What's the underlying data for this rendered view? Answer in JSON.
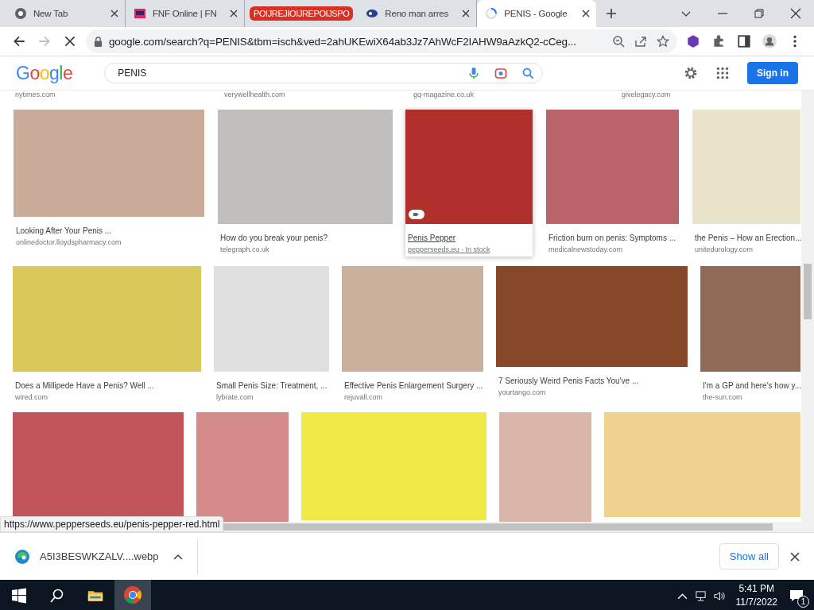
{
  "tabs": [
    {
      "kind": "tab",
      "label": "New Tab",
      "selected": false
    },
    {
      "kind": "tab",
      "label": "FNF Online | FN",
      "selected": false
    },
    {
      "kind": "group",
      "label": "POIJREJIOIJREPOIJSPO",
      "color": "#d93025",
      "selected": false
    },
    {
      "kind": "tab",
      "label": "Reno man arres",
      "selected": false
    },
    {
      "kind": "tab",
      "label": "PENIS - Google",
      "selected": true
    }
  ],
  "address": {
    "url": "google.com/search?q=PENIS&tbm=isch&ved=2ahUKEwiX64ab3Jz7AhWcF2IAHW9aAzkQ2-cCeg...",
    "loading": true
  },
  "google": {
    "logo": "Google",
    "query": "PENIS",
    "sign_in": "Sign in"
  },
  "partial_sources": [
    "nytimes.com",
    "verywellhealth.com",
    "gq-magazine.co.uk",
    "givelegacy.com"
  ],
  "rows": [
    [
      {
        "title": "Looking After Your Penis ...",
        "source": "onlinedoctor.lloydspharmacy.com",
        "color": "#c9ab99",
        "selected": false
      },
      {
        "title": "How do you break your penis?",
        "source": "telegraph.co.uk",
        "color": "#c1bebb",
        "selected": false
      },
      {
        "title": "Penis Pepper",
        "source": "pepperseeds.eu · In stock",
        "color": "#b0312b",
        "selected": true
      },
      {
        "title": "Friction burn on penis: Symptoms ...",
        "source": "medicalnewstoday.com",
        "color": "#ba636b",
        "selected": false
      },
      {
        "title": "the Penis – How an Erection...",
        "source": "unitedurology.com",
        "color": "#e9e3c9",
        "selected": false
      }
    ],
    [
      {
        "title": "Does a Millipede Have a Penis? Well ...",
        "source": "wired.com",
        "color": "#dbc85b",
        "selected": false
      },
      {
        "title": "Small Penis Size: Treatment, ...",
        "source": "lybrate.com",
        "color": "#e0e0e0",
        "selected": false
      },
      {
        "title": "Effective Penis Enlargement Surgery ...",
        "source": "rejuvall.com",
        "color": "#cbb09c",
        "selected": false
      },
      {
        "title": "7 Seriously Weird Penis Facts You've ...",
        "source": "yourtango.com",
        "color": "#874728",
        "selected": false
      },
      {
        "title": "I'm a GP and here's how y...",
        "source": "the-sun.com",
        "color": "#8f6b57",
        "selected": false
      }
    ],
    [
      {
        "color": "#c2545b",
        "selected": false
      },
      {
        "color": "#d58b8a",
        "selected": false
      },
      {
        "color": "#efea46",
        "selected": false
      },
      {
        "color": "#d9b4a9",
        "selected": false
      },
      {
        "color": "#efd290",
        "selected": false
      }
    ]
  ],
  "status_url": "https://www.pepperseeds.eu/penis-pepper-red.html",
  "download": {
    "file": "A5I3BESWKZALV....webp",
    "show_all": "Show all"
  },
  "taskbar": {
    "time": "5:41 PM",
    "date": "11/7/2022",
    "notifications": "1"
  }
}
